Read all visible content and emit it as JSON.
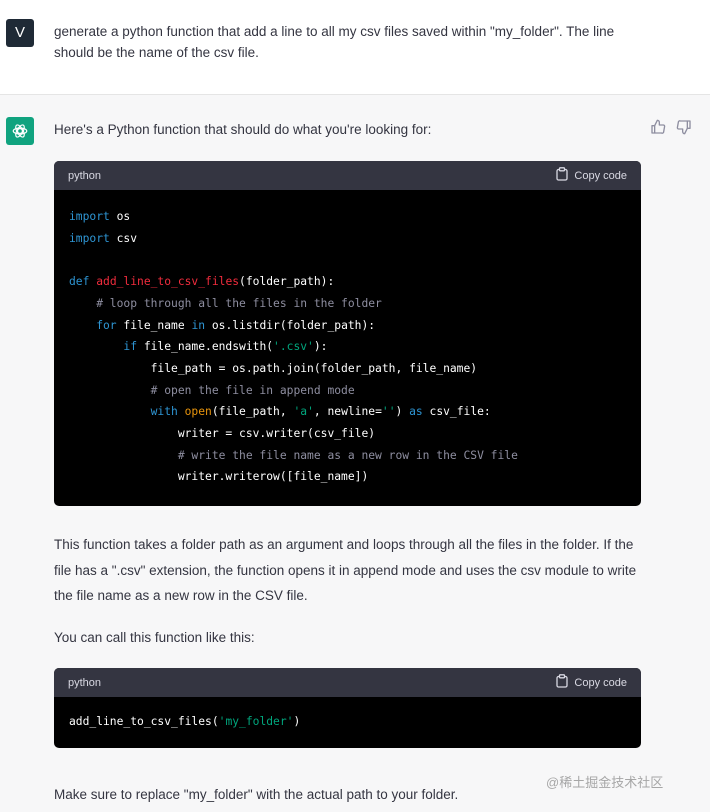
{
  "user_message": {
    "avatar": "V",
    "text": "generate a python function that add a line to all my csv files saved within \"my_folder\". The line should be the name of the csv file."
  },
  "assistant": {
    "intro": "Here's a Python function that should do what you're looking for:",
    "code_block_1": {
      "language": "python",
      "copy_label": "Copy code",
      "lines": {
        "l1_kw": "import",
        "l1_rest": " os",
        "l2_kw": "import",
        "l2_rest": " csv",
        "l3_def": "def",
        "l3_name": "add_line_to_csv_files",
        "l3_rest": "(folder_path):",
        "l4": "    # loop through all the files in the folder",
        "l5_for": "    for",
        "l5_mid": " file_name ",
        "l5_in": "in",
        "l5_rest": " os.listdir(folder_path):",
        "l6_if": "        if",
        "l6_mid": " file_name.endswith(",
        "l6_str": "'.csv'",
        "l6_end": "):",
        "l7": "            file_path = os.path.join(folder_path, file_name)",
        "l8": "            # open the file in append mode",
        "l9_with": "            with",
        "l9_open": " open",
        "l9_a": "(file_path, ",
        "l9_s1": "'a'",
        "l9_b": ", newline=",
        "l9_s2": "''",
        "l9_c": ") ",
        "l9_as": "as",
        "l9_d": " csv_file:",
        "l10": "                writer = csv.writer(csv_file)",
        "l11": "                # write the file name as a new row in the CSV file",
        "l12": "                writer.writerow([file_name])"
      }
    },
    "explanation": "This function takes a folder path as an argument and loops through all the files in the folder. If the file has a \".csv\" extension, the function opens it in append mode and uses the csv module to write the file name as a new row in the CSV file.",
    "call_intro": "You can call this function like this:",
    "code_block_2": {
      "language": "python",
      "copy_label": "Copy code",
      "call_a": "add_line_to_csv_files(",
      "call_str": "'my_folder'",
      "call_b": ")"
    },
    "closing": "Make sure to replace \"my_folder\" with the actual path to your folder."
  },
  "watermark": "@稀土掘金技术社区",
  "colors": {
    "assistant_bg": "#f7f7f8",
    "accent": "#10a37f",
    "code_bg": "#000000",
    "code_header_bg": "#343541",
    "keyword": "#2e95d3",
    "function_name": "#f22c3d",
    "string": "#00a67d",
    "builtin": "#e9950c",
    "comment": "#8e8ea0"
  },
  "icons": [
    "openai-logo-icon",
    "thumbs-up-icon",
    "thumbs-down-icon",
    "clipboard-icon"
  ]
}
